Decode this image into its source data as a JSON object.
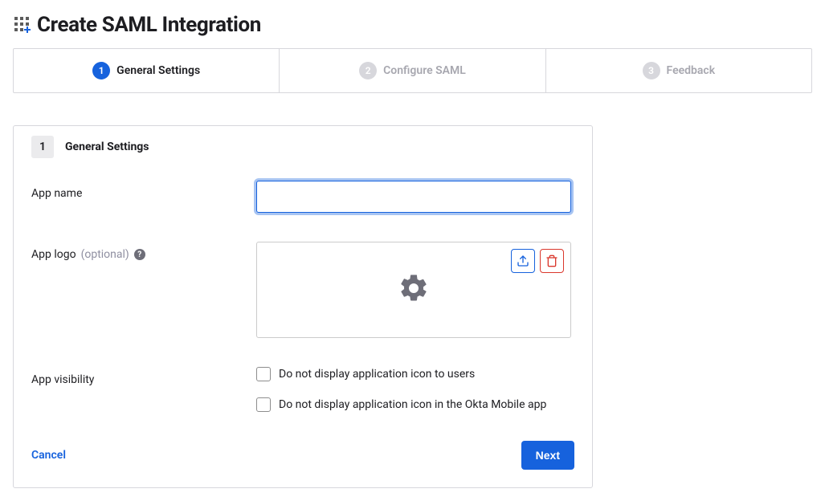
{
  "header": {
    "title": "Create SAML Integration"
  },
  "steps": [
    {
      "num": "1",
      "label": "General Settings",
      "active": true
    },
    {
      "num": "2",
      "label": "Configure SAML",
      "active": false
    },
    {
      "num": "3",
      "label": "Feedback",
      "active": false
    }
  ],
  "panel": {
    "num": "1",
    "title": "General Settings"
  },
  "form": {
    "app_name": {
      "label": "App name",
      "value": ""
    },
    "app_logo": {
      "label": "App logo",
      "optional": "(optional)"
    },
    "visibility": {
      "label": "App visibility",
      "options": [
        "Do not display application icon to users",
        "Do not display application icon in the Okta Mobile app"
      ]
    }
  },
  "actions": {
    "cancel": "Cancel",
    "next": "Next"
  }
}
